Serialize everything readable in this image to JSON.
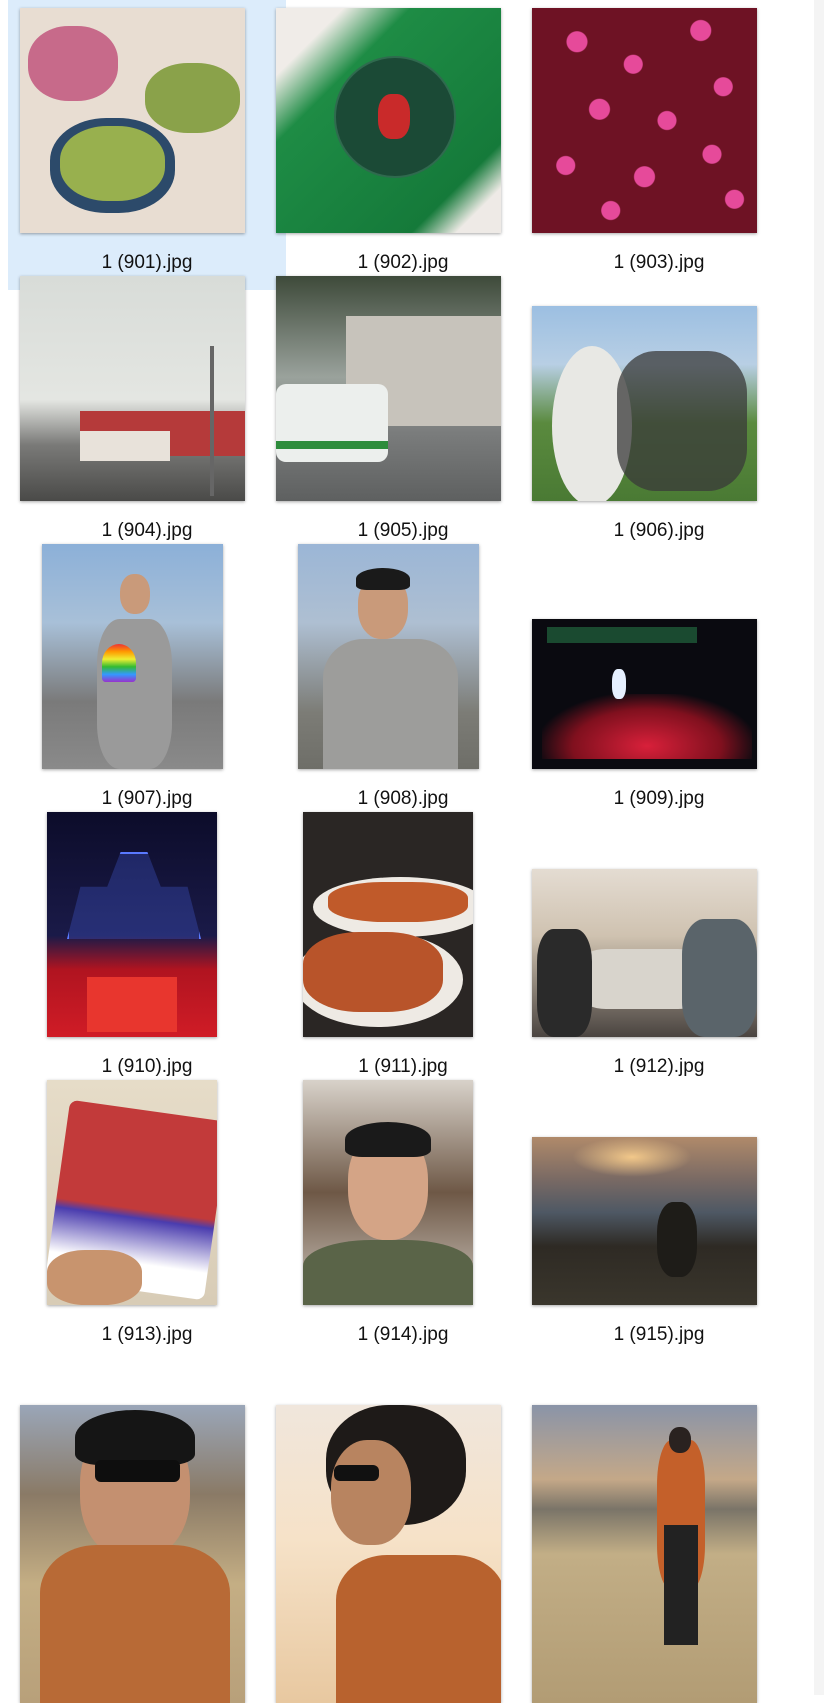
{
  "files": [
    {
      "name": "1 (901).jpg",
      "selected": true,
      "subject": "shaved ice desserts on terrazzo table"
    },
    {
      "name": "1 (902).jpg",
      "selected": false,
      "subject": "christmas sticker on green wrapping"
    },
    {
      "name": "1 (903).jpg",
      "selected": false,
      "subject": "pink confetti on dark red surface"
    },
    {
      "name": "1 (904).jpg",
      "selected": false,
      "subject": "street with birds on wires"
    },
    {
      "name": "1 (905).jpg",
      "selected": false,
      "subject": "van parked by building"
    },
    {
      "name": "1 (906).jpg",
      "selected": false,
      "subject": "fisheye group photo"
    },
    {
      "name": "1 (907).jpg",
      "selected": false,
      "subject": "pride parade portrait with rainbow fan"
    },
    {
      "name": "1 (908).jpg",
      "selected": false,
      "subject": "portrait in grey cardigan"
    },
    {
      "name": "1 (909).jpg",
      "selected": false,
      "subject": "concert stage with red lights"
    },
    {
      "name": "1 (910).jpg",
      "selected": false,
      "subject": "drone light castle over stage"
    },
    {
      "name": "1 (911).jpg",
      "selected": false,
      "subject": "plates of hairy crabs"
    },
    {
      "name": "1 (912).jpg",
      "selected": false,
      "subject": "group dinner selfie"
    },
    {
      "name": "1 (913).jpg",
      "selected": false,
      "subject": "staff badge held in hand"
    },
    {
      "name": "1 (914).jpg",
      "selected": false,
      "subject": "selfie in hotel room"
    },
    {
      "name": "1 (915).jpg",
      "selected": false,
      "subject": "sunset over rocky coast"
    },
    {
      "name": "",
      "selected": false,
      "subject": "selfie with sunglasses in field"
    },
    {
      "name": "",
      "selected": false,
      "subject": "profile with sunglasses backlit"
    },
    {
      "name": "",
      "selected": false,
      "subject": "man in orange jacket in field"
    }
  ],
  "colors": {
    "selection": "#dcecfb",
    "background": "#ffffff",
    "text": "#111111"
  }
}
